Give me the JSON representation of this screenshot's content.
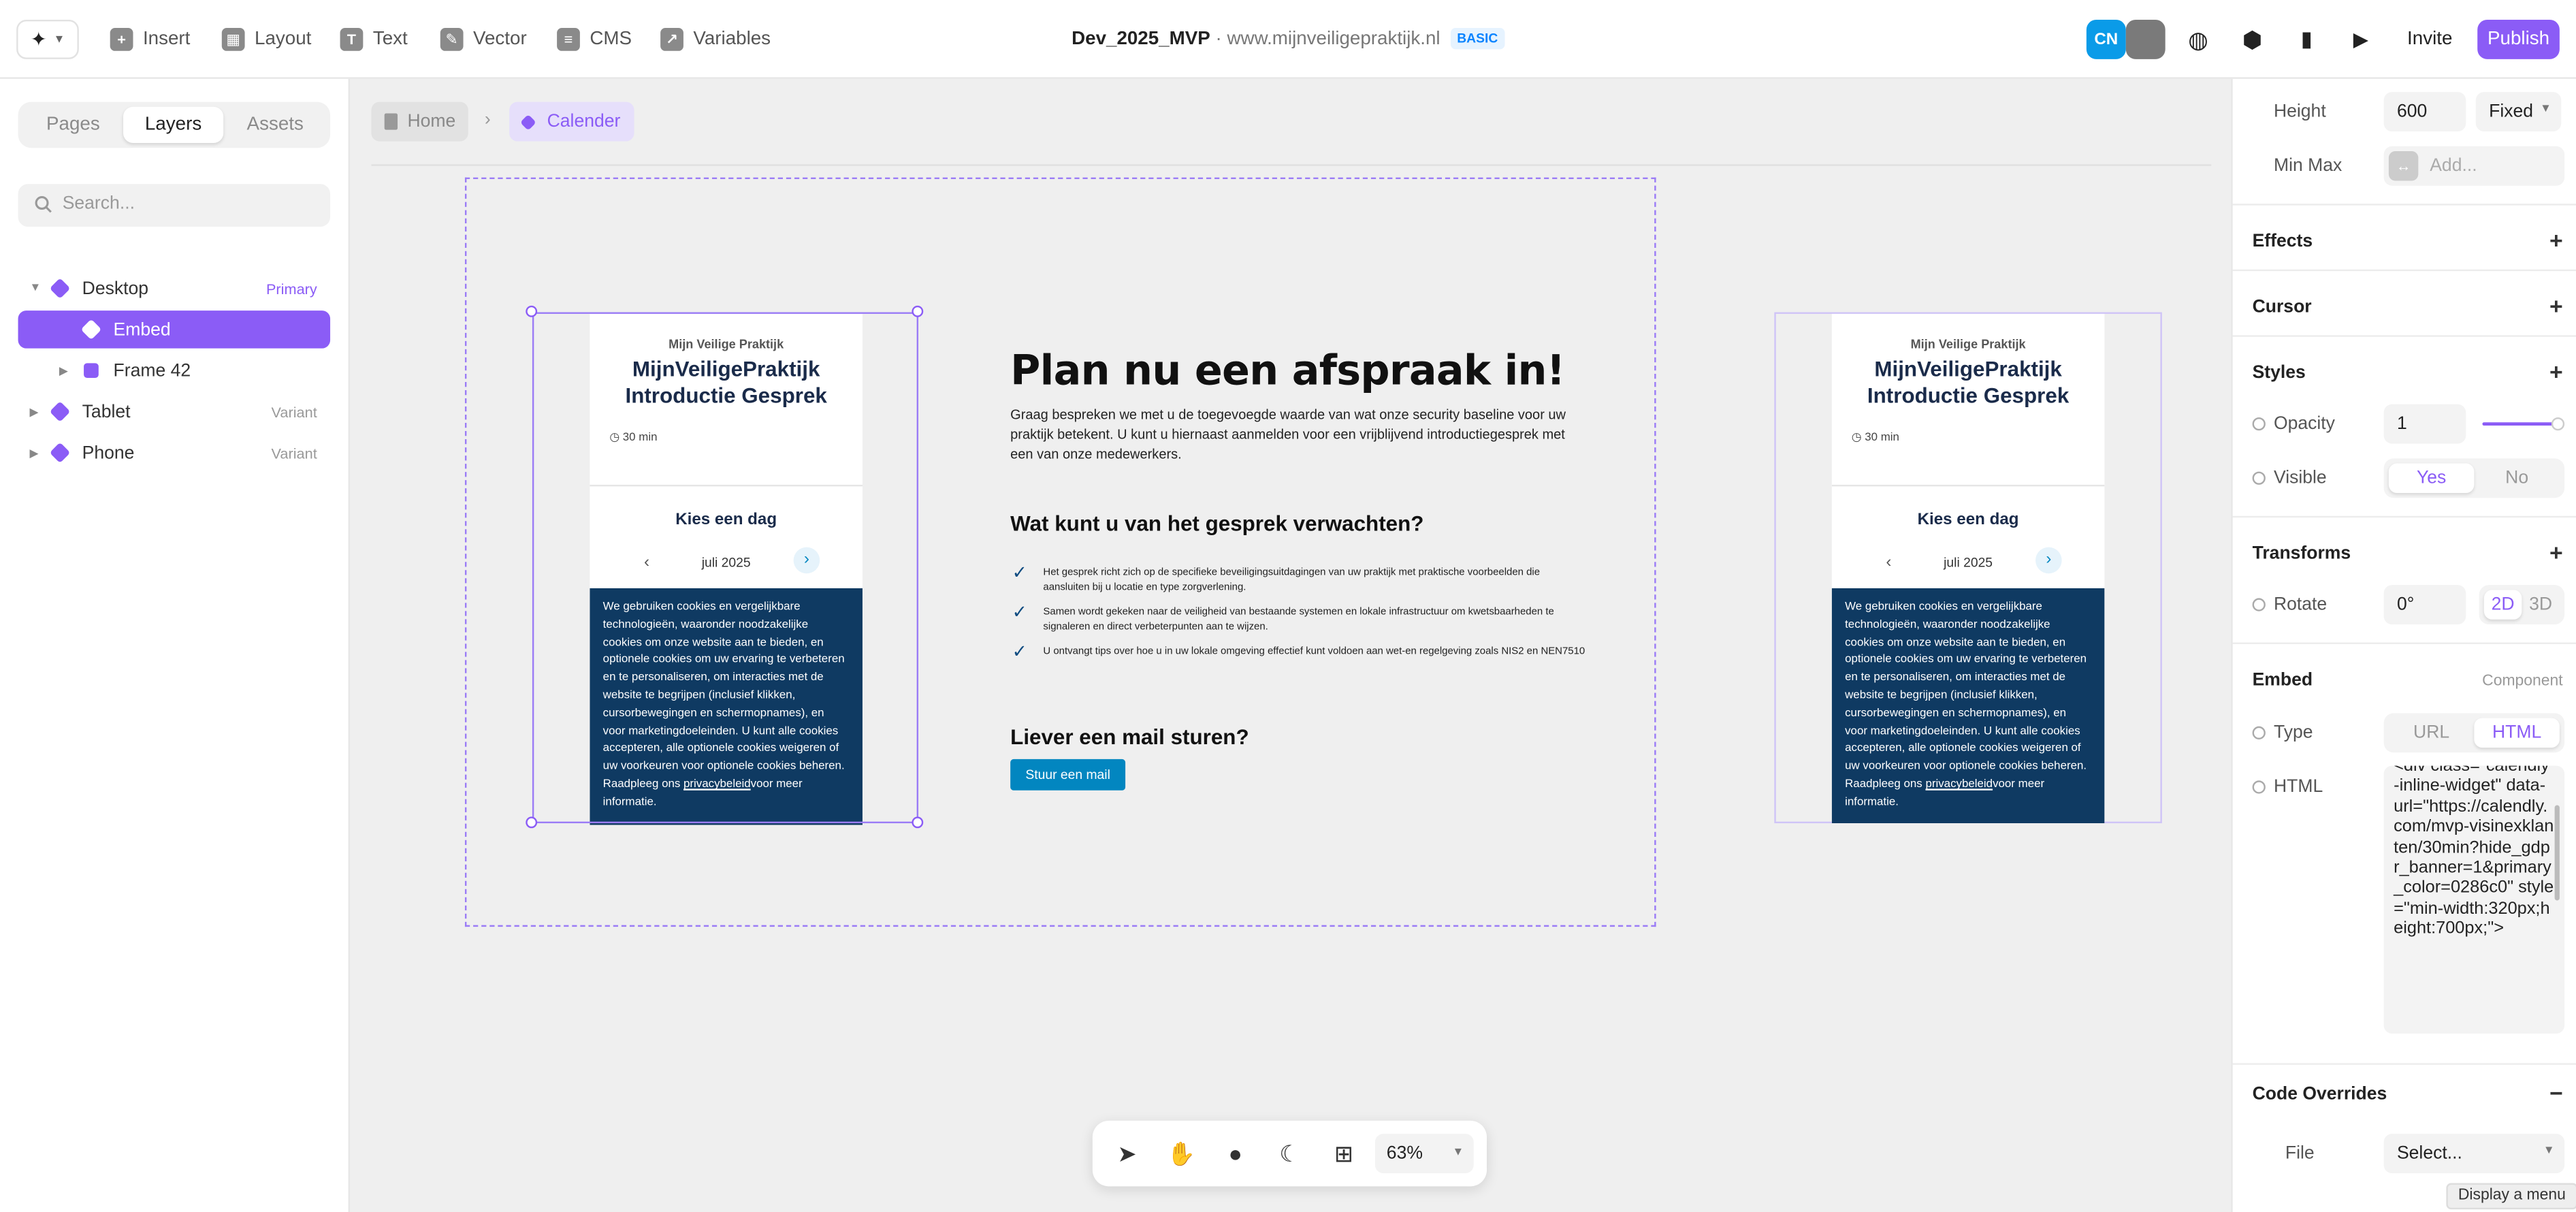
{
  "topbar": {
    "tools": [
      "Insert",
      "Layout",
      "Text",
      "Vector",
      "CMS",
      "Variables"
    ],
    "project": "Dev_2025_MVP",
    "domain": "www.mijnveiligepraktijk.nl",
    "plan": "BASIC",
    "avatar": "CN",
    "invite": "Invite",
    "publish": "Publish"
  },
  "left": {
    "tabs": [
      "Pages",
      "Layers",
      "Assets"
    ],
    "search_placeholder": "Search...",
    "layers": [
      {
        "name": "Desktop",
        "tag": "Primary"
      },
      {
        "name": "Embed",
        "tag": ""
      },
      {
        "name": "Frame 42",
        "tag": ""
      },
      {
        "name": "Tablet",
        "tag": "Variant"
      },
      {
        "name": "Phone",
        "tag": "Variant"
      }
    ]
  },
  "canvas": {
    "breadcrumb": [
      "Home",
      "Calender"
    ],
    "heading": "Plan nu een afspraak in!",
    "intro": "Graag bespreken we met u de toegevoegde waarde van wat onze security baseline voor uw praktijk betekent. U kunt u hiernaast aanmelden voor een vrijblijvend introductiegesprek met een van onze medewerkers.",
    "expect_title": "Wat kunt u van het gesprek verwachten?",
    "bullets": [
      "Het gesprek richt zich op de specifieke beveiligingsuitdagingen van uw praktijk met praktische voorbeelden die aansluiten bij u locatie en type zorgverlening.",
      "Samen wordt gekeken naar de veiligheid van bestaande systemen en lokale infrastructuur om kwetsbaarheden te signaleren en direct verbeterpunten aan te wijzen.",
      "U ontvangt tips over hoe u in uw lokale omgeving effectief kunt voldoen aan wet-en regelgeving zoals NIS2 en NEN7510"
    ],
    "mail_title": "Liever een mail sturen?",
    "mail_button": "Stuur een mail",
    "calendly": {
      "org": "Mijn Veilige Praktijk",
      "event_title": "MijnVeiligePraktijk Introductie Gesprek",
      "duration": "30 min",
      "choose_day": "Kies een dag",
      "month": "juli 2025",
      "cookie_text": "We gebruiken cookies en vergelijkbare technologieën, waaronder noodzakelijke cookies om onze website aan te bieden, en optionele cookies om uw ervaring te verbeteren en te personaliseren, om interacties met de website te begrijpen (inclusief klikken, cursorbewegingen en schermopnames), en voor marketingdoeleinden. U kunt alle cookies accepteren, alle optionele cookies weigeren of uw voorkeuren voor optionele cookies beheren. Raadpleeg ons ",
      "cookie_link": "privacybeleid",
      "cookie_tail": "voor meer informatie."
    },
    "zoom": "63%"
  },
  "right": {
    "height_label": "Height",
    "height_value": "600",
    "height_mode": "Fixed",
    "minmax_label": "Min Max",
    "minmax_placeholder": "Add...",
    "effects": "Effects",
    "cursor": "Cursor",
    "styles": "Styles",
    "opacity_label": "Opacity",
    "opacity_value": "1",
    "visible_label": "Visible",
    "visible_yes": "Yes",
    "visible_no": "No",
    "transforms": "Transforms",
    "rotate_label": "Rotate",
    "rotate_value": "0°",
    "rot_2d": "2D",
    "rot_3d": "3D",
    "embed": "Embed",
    "embed_component": "Component",
    "type_label": "Type",
    "type_url": "URL",
    "type_html": "HTML",
    "html_label": "HTML",
    "html_code": "<div class=\"calendly-inline-widget\" data-url=\"https://calendly.com/mvp-visinexklanten/30min?hide_gdpr_banner=1&primary_color=0286c0\" style=\"min-width:320px;height:700px;\">",
    "code_overrides": "Code Overrides",
    "file_label": "File",
    "file_placeholder": "Select...",
    "tooltip": "Display a menu"
  },
  "colors": {
    "accent": "#8b5cf6",
    "publish": "#8b5cf6",
    "calendly_blue": "#0286c0",
    "cookie_bg": "#0f3a62"
  }
}
